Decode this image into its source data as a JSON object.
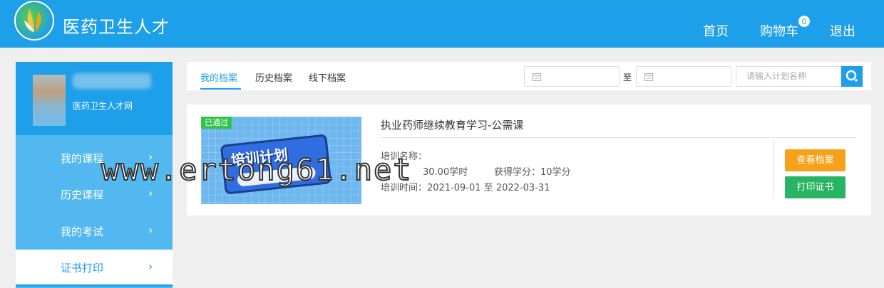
{
  "header": {
    "brand": "医药卫生人才",
    "nav": {
      "home": "首页",
      "cart": "购物车",
      "cart_count": "0",
      "logout": "退出"
    }
  },
  "sidebar": {
    "profile_site": "医药卫生人才网",
    "items": [
      {
        "label": "我的课程"
      },
      {
        "label": "历史课程"
      },
      {
        "label": "我的考试"
      },
      {
        "label": "证书打印"
      }
    ],
    "chevron": "›"
  },
  "tabs": {
    "items": [
      "我的档案",
      "历史档案",
      "线下档案"
    ],
    "active": "我的档案"
  },
  "filter": {
    "to_label": "至",
    "search_placeholder": "请输入计划名称"
  },
  "record": {
    "status_badge": "已通过",
    "thumbnail_title": "培训计划",
    "title": "执业药师继续教育学习-公需课",
    "training_name_label": "培训名称：",
    "hours_text": "30.00学时",
    "credits_text": "获得学分：10学分",
    "period_text": "培训时间：2021-09-01 至 2022-03-31",
    "view_button": "查看档案",
    "print_button": "打印证书"
  },
  "watermark": "www.ertong61.net",
  "colors": {
    "primary": "#1e9fe9",
    "sidebar": "#53b8ef",
    "orange": "#f7a11a",
    "green": "#28b463"
  }
}
